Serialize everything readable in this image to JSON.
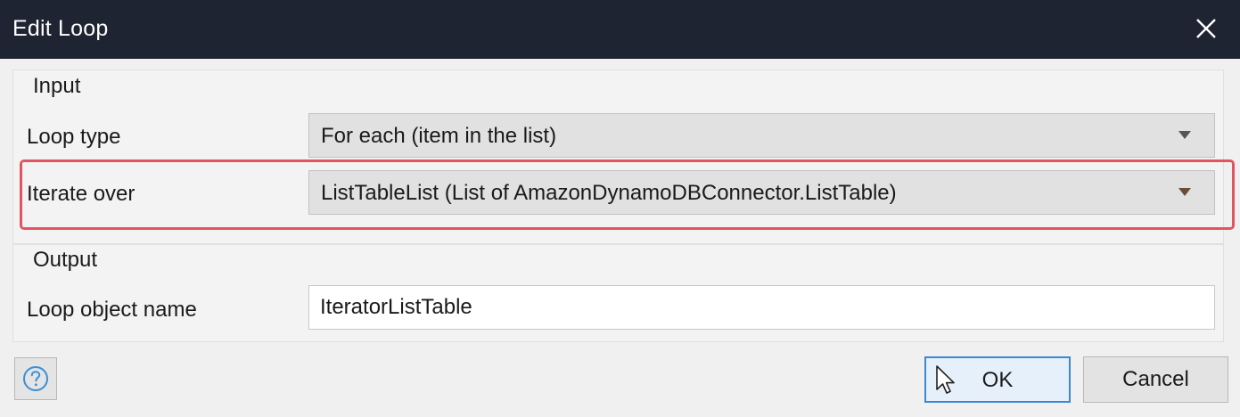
{
  "window": {
    "title": "Edit Loop"
  },
  "input_group": {
    "title": "Input",
    "loop_type": {
      "label": "Loop type",
      "value": "For each (item in the list)"
    },
    "iterate_over": {
      "label": "Iterate over",
      "value": "ListTableList (List of AmazonDynamoDBConnector.ListTable)"
    }
  },
  "output_group": {
    "title": "Output",
    "loop_object_name": {
      "label": "Loop object name",
      "value": "IteratorListTable"
    }
  },
  "buttons": {
    "ok": "OK",
    "cancel": "Cancel"
  },
  "icons": {
    "close": "close-icon",
    "help": "help-icon",
    "dropdown": "chevron-down-icon",
    "cursor": "mouse-pointer-icon"
  },
  "colors": {
    "titlebar": "#1f2433",
    "highlight": "#e05560",
    "ok_border": "#3c86d6"
  }
}
